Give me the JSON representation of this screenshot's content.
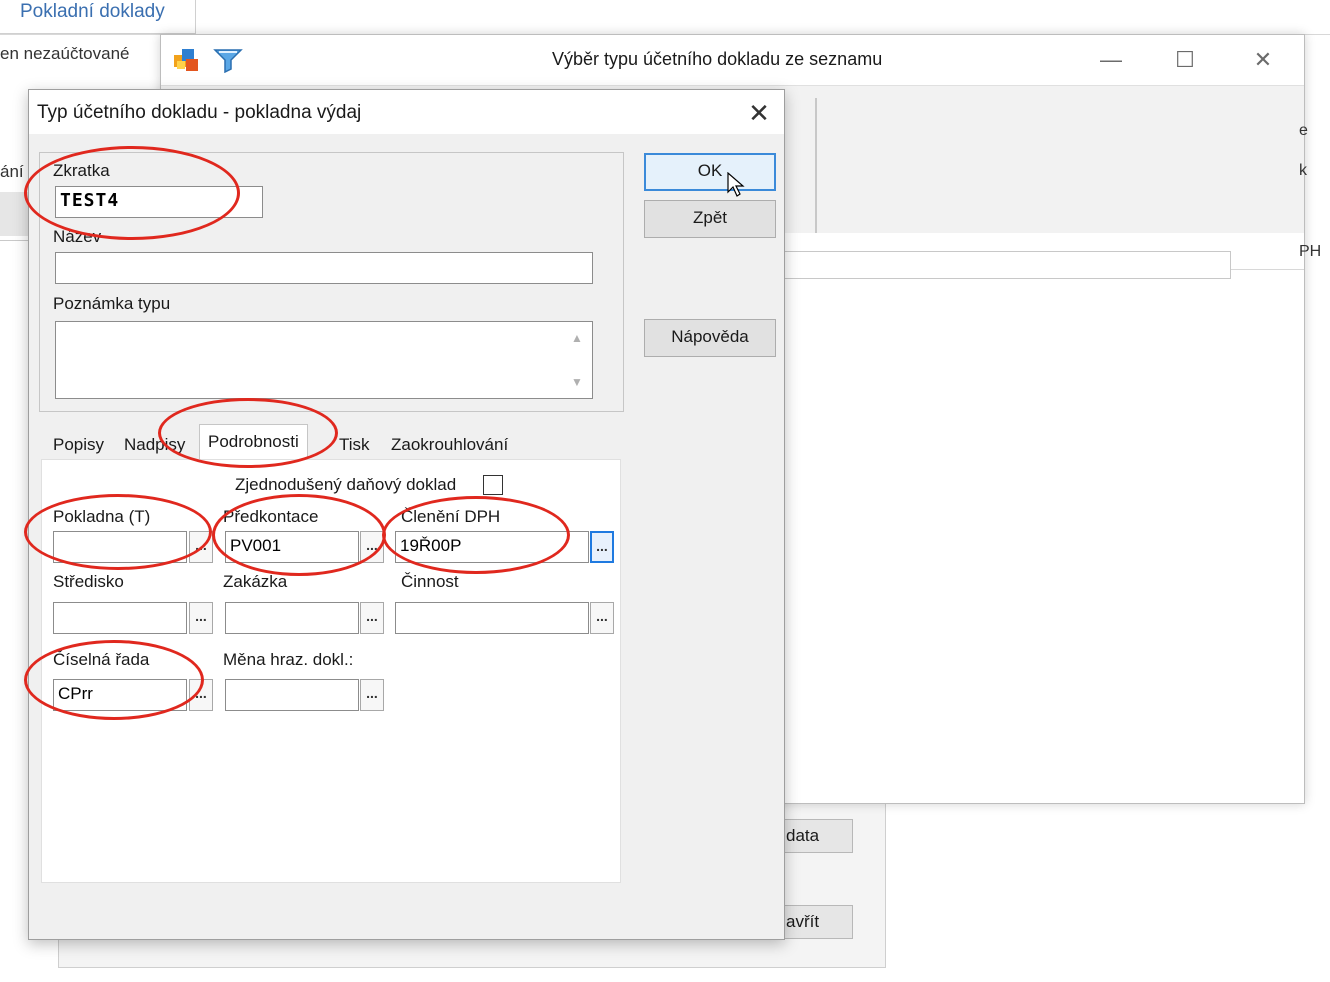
{
  "background": {
    "tab_title": "Pokladní doklady",
    "filter_label": "en nezaúčtované",
    "side_label": "ání",
    "right_fragments": [
      "e",
      "k",
      "PH"
    ],
    "back_buttons": [
      "data",
      "avřít"
    ]
  },
  "selection_window": {
    "title": "Výběr typu účetního dokladu ze seznamu",
    "controls": {
      "minimize": "—",
      "maximize": "☐",
      "close": "✕"
    }
  },
  "dialog": {
    "title": "Typ účetního dokladu - pokladna výdaj",
    "close_glyph": "✕",
    "fields": {
      "zkratka": {
        "label": "Zkratka",
        "value": "TEST4"
      },
      "nazev": {
        "label": "Název",
        "value": ""
      },
      "poznamka": {
        "label": "Poznámka typu",
        "value": ""
      }
    },
    "buttons": {
      "ok": "OK",
      "zpet": "Zpět",
      "napoveda": "Nápověda"
    },
    "tabs": [
      "Popisy",
      "Nadpisy",
      "Podrobnosti",
      "Tisk",
      "Zaokrouhlování"
    ],
    "active_tab": "Podrobnosti",
    "details": {
      "zjednoduseny": {
        "label": "Zjednodušený daňový doklad",
        "checked": false
      },
      "pokladna": {
        "label": "Pokladna (T)",
        "value": ""
      },
      "predkontace": {
        "label": "Předkontace",
        "value": "PV001"
      },
      "cleneni_dph": {
        "label": "Členění DPH",
        "value": "19Ř00P"
      },
      "stredisko": {
        "label": "Středisko",
        "value": ""
      },
      "zakazka": {
        "label": "Zakázka",
        "value": ""
      },
      "cinnost": {
        "label": "Činnost",
        "value": ""
      },
      "ciselna_rada": {
        "label": "Číselná řada",
        "value": "CPrr"
      },
      "mena": {
        "label": "Měna hraz. dokl.:",
        "value": ""
      }
    },
    "ellipsis": "..."
  },
  "annotation_color": "#e0281e"
}
